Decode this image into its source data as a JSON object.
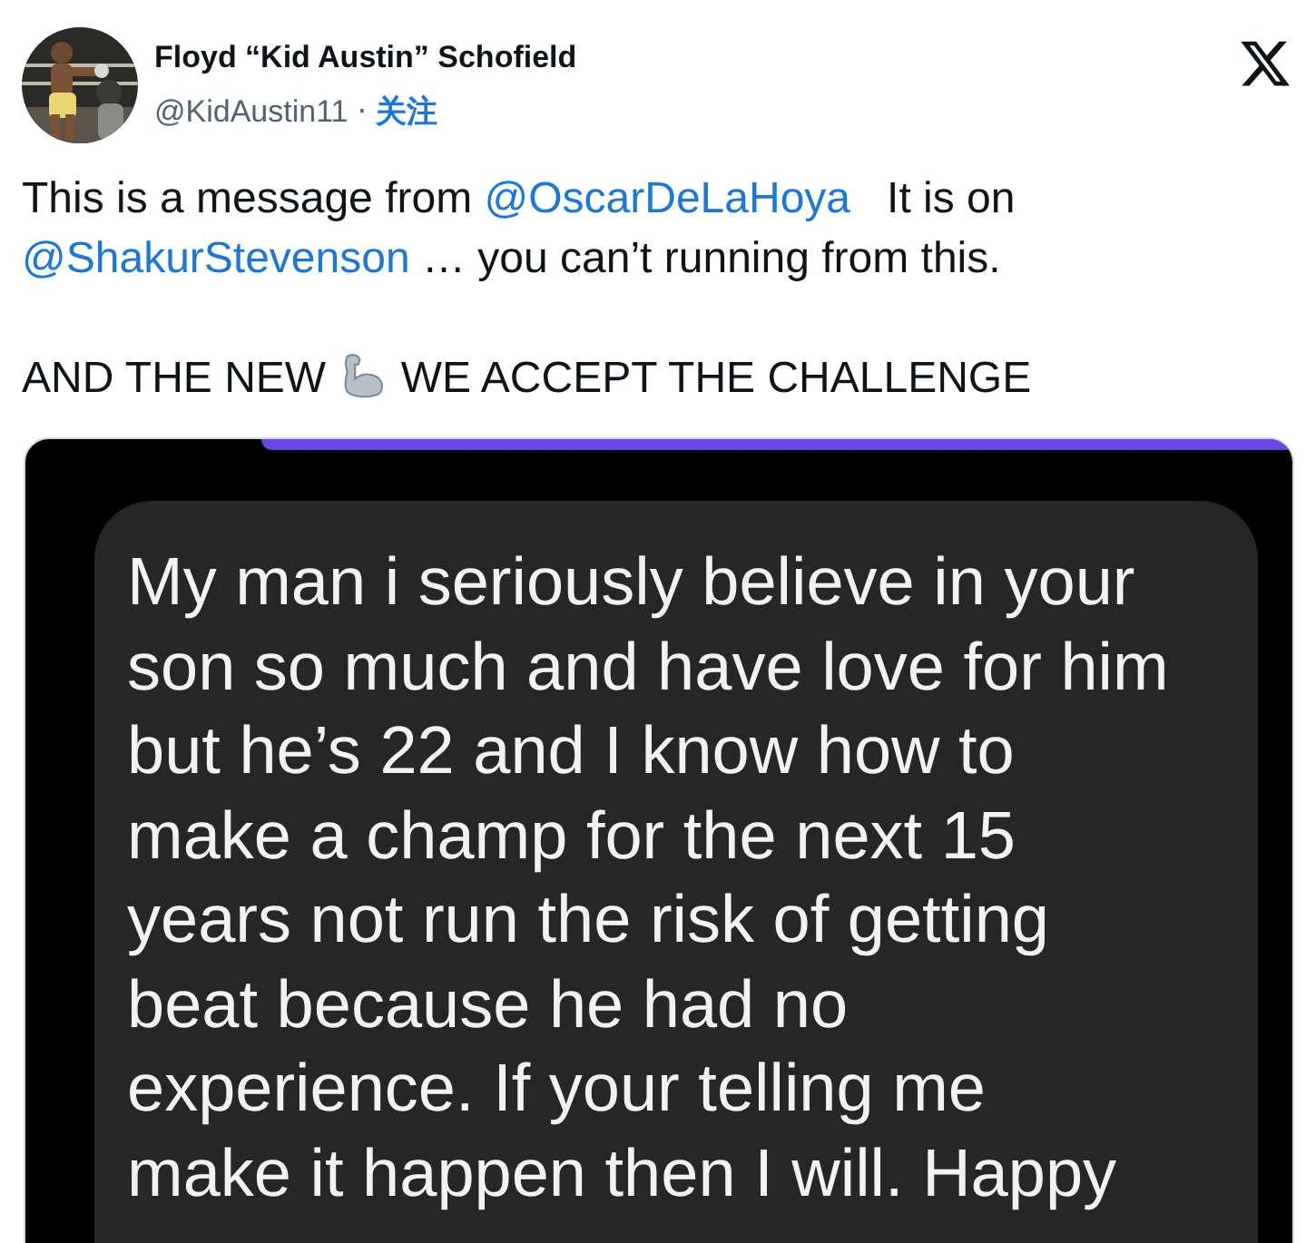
{
  "author": {
    "name": "Floyd “Kid Austin” Schofield",
    "handle": "@KidAustin11",
    "separator": "·",
    "follow": "关注"
  },
  "tweet": {
    "paragraphs": [
      [
        {
          "kind": "text",
          "text": "This is a message from "
        },
        {
          "kind": "mention",
          "text": "@OscarDeLaHoya"
        },
        {
          "kind": "text",
          "text": "   It is on"
        },
        {
          "kind": "break"
        },
        {
          "kind": "mention",
          "text": "@ShakurStevenson"
        },
        {
          "kind": "text",
          "text": " … you can’t running from this."
        }
      ],
      [
        {
          "kind": "text",
          "text": "AND THE NEW "
        },
        {
          "kind": "emoji"
        },
        {
          "kind": "text",
          "text": " WE ACCEPT THE CHALLENGE"
        }
      ]
    ]
  },
  "media": {
    "kind": "screenshot",
    "message_lines": [
      "My man i seriously believe in your",
      "son so much and have love for him",
      "but he’s 22 and I know how to",
      "make a champ for the next 15",
      "years not run the risk of getting",
      "beat because he had no",
      "experience. If your telling me",
      "make it happen then I will. Happy"
    ]
  }
}
